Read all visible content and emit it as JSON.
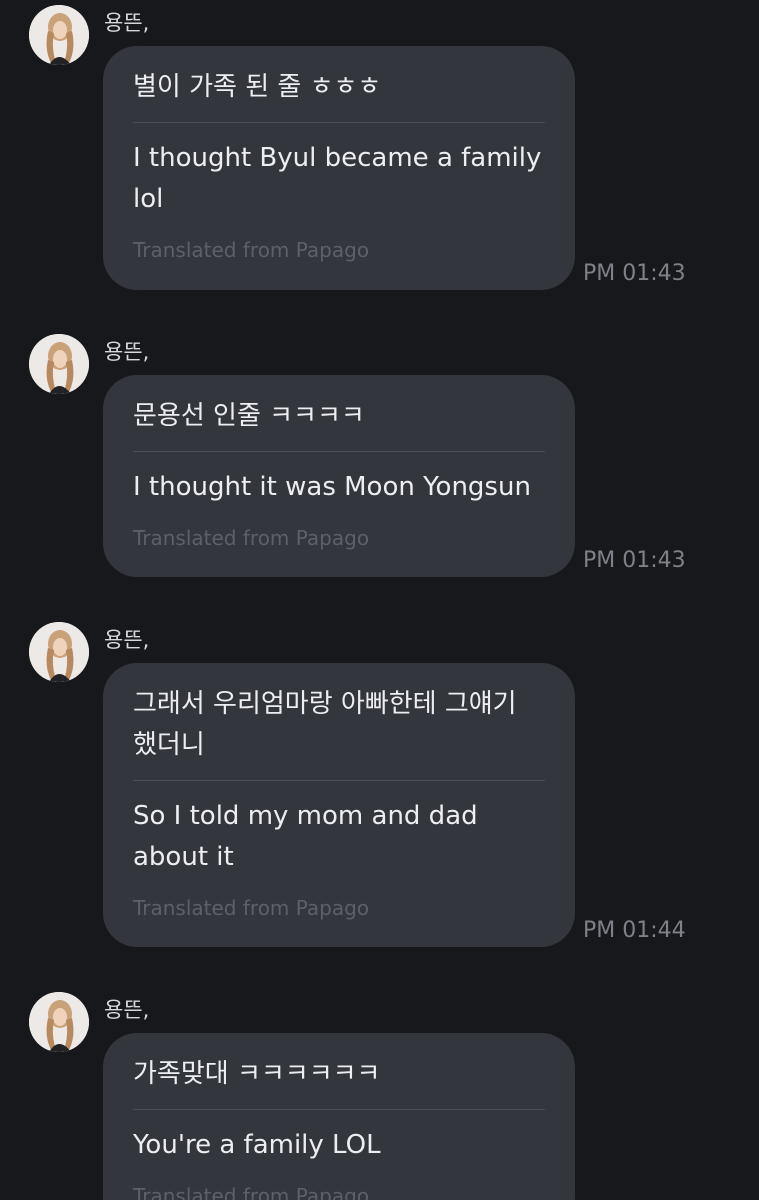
{
  "messages": [
    {
      "sender": "용뜬,",
      "original": "별이 가족 된 줄 ㅎㅎㅎ",
      "translation": "I thought Byul became a family\nlol",
      "note": "Translated from Papago",
      "time": "PM 01:43"
    },
    {
      "sender": "용뜬,",
      "original": "문용선 인줄 ㅋㅋㅋㅋ",
      "translation": "I thought it was Moon Yongsun",
      "note": "Translated from Papago",
      "time": "PM 01:43"
    },
    {
      "sender": "용뜬,",
      "original": "그래서 우리엄마랑 아빠한테 그얘기\n했더니",
      "translation": "So I told my mom and dad\nabout it",
      "note": "Translated from Papago",
      "time": "PM 01:44"
    },
    {
      "sender": "용뜬,",
      "original": "가족맞대 ㅋㅋㅋㅋㅋㅋ",
      "translation": "You're a family LOL",
      "note": "Translated from Papago",
      "time": ""
    }
  ],
  "avatar_icon": "profile-photo-avatar",
  "colors": {
    "background": "#17181b",
    "bubble": "#33363d",
    "text": "#eceef2",
    "muted": "#5c6069",
    "time": "#7d818a"
  }
}
